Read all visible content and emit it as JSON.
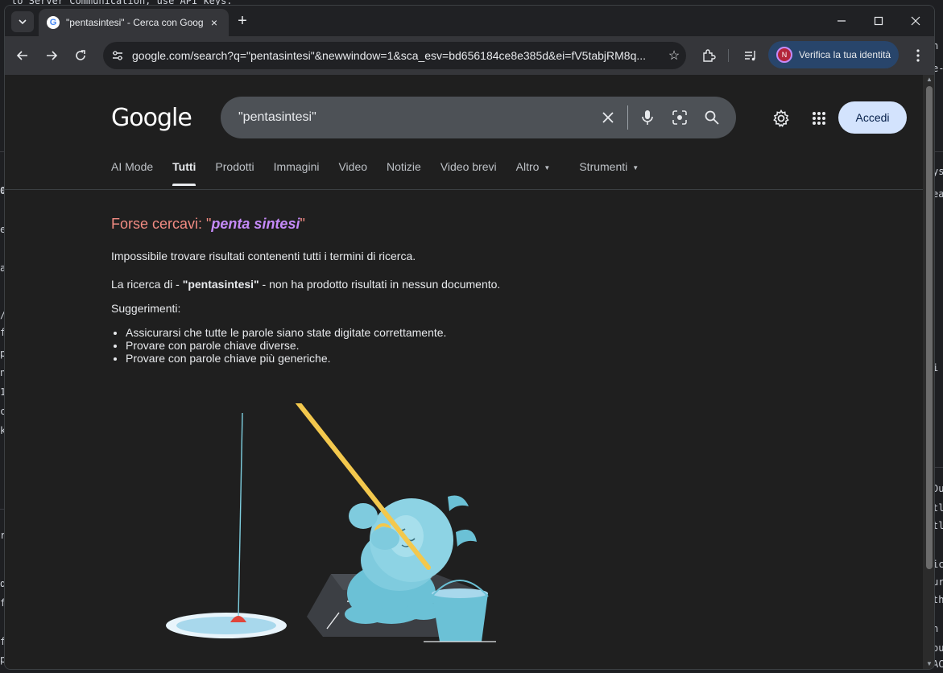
{
  "tab": {
    "title": "\"pentasintesi\" - Cerca con Goog",
    "close": "×",
    "new_tab": "+"
  },
  "toolbar": {
    "url": "google.com/search?q=\"pentasintesi\"&newwindow=1&sca_esv=bd656184ce8e385d&ei=fV5tabjRM8q...",
    "profile_initial": "N",
    "profile_label": "Verifica la tua identità"
  },
  "google": {
    "logo": "Google",
    "query": "\"pentasintesi\"",
    "login_label": "Accedi"
  },
  "search_tabs": [
    {
      "label": "AI Mode"
    },
    {
      "label": "Tutti"
    },
    {
      "label": "Prodotti"
    },
    {
      "label": "Immagini"
    },
    {
      "label": "Video"
    },
    {
      "label": "Notizie"
    },
    {
      "label": "Video brevi"
    },
    {
      "label": "Altro"
    },
    {
      "label": "Strumenti"
    }
  ],
  "results": {
    "did_you_mean_prefix": "Forse cercavi: \"",
    "did_you_mean_term": "penta sintesi",
    "did_you_mean_suffix": "\"",
    "no_results": "Impossibile trovare risultati contenenti tutti i termini di ricerca.",
    "search_prefix": "La ricerca di - ",
    "search_term": "\"pentasintesi\"",
    "search_suffix": " - non ha prodotto risultati in nessun documento.",
    "suggestions_title": "Suggerimenti:",
    "suggestions": [
      "Assicurarsi che tutte le parole siano state digitate correttamente.",
      "Provare con parole chiave diverse.",
      "Provare con parole chiave più generiche."
    ]
  },
  "background_editor": {
    "lines": [
      "to Server Communication, use API keys.",
      "n",
      "e-l",
      "0",
      "e",
      "a",
      "/",
      "f",
      "p",
      "n",
      "1",
      "c",
      "k",
      "r",
      "d",
      "f",
      "f",
      "p",
      "ys",
      "ea",
      "i",
      "Du",
      "tl",
      "tl",
      "ic",
      "ur",
      "th",
      "n",
      "ou",
      "AC"
    ]
  },
  "icons": [
    "chevron-down-icon",
    "close-icon",
    "plus-icon",
    "minimize-icon",
    "maximize-icon",
    "back-icon",
    "forward-icon",
    "reload-icon",
    "site-info-icon",
    "star-icon",
    "extensions-icon",
    "media-icon",
    "menu-icon",
    "clear-icon",
    "mic-icon",
    "lens-icon",
    "search-icon",
    "gear-icon",
    "apps-icon"
  ],
  "colors": {
    "page_bg": "#1f1f1f",
    "chrome_bg": "#202124",
    "toolbar_bg": "#35363a",
    "link_purple": "#c58af9",
    "did_you_mean": "#f28b82",
    "accedi_bg": "#d3e3fd"
  }
}
